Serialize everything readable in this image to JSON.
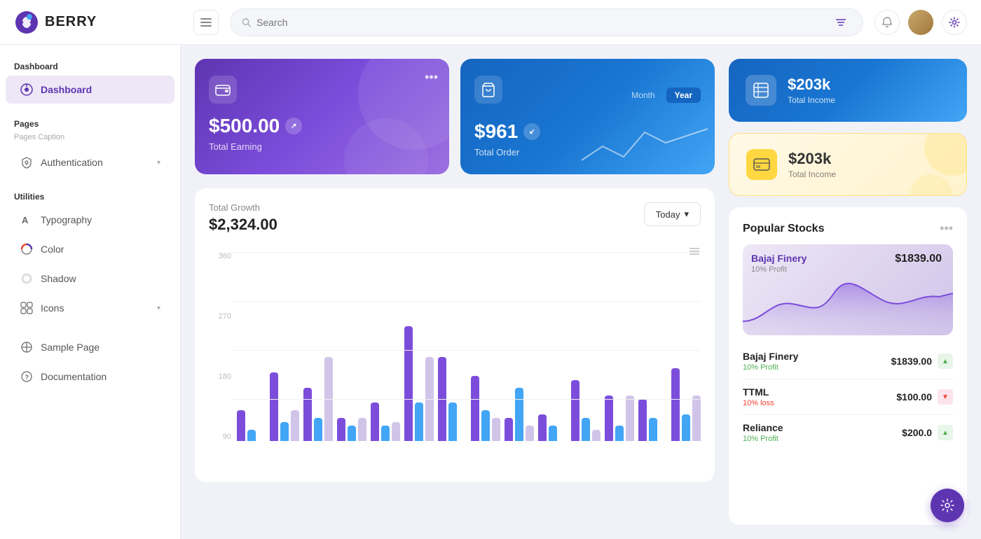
{
  "header": {
    "logo_text": "BERRY",
    "search_placeholder": "Search",
    "menu_label": "Menu"
  },
  "sidebar": {
    "dashboard_section": "Dashboard",
    "dashboard_item": "Dashboard",
    "pages_section": "Pages",
    "pages_caption": "Pages Caption",
    "authentication_item": "Authentication",
    "utilities_section": "Utilities",
    "typography_item": "Typography",
    "color_item": "Color",
    "shadow_item": "Shadow",
    "icons_item": "Icons",
    "sample_page_item": "Sample Page",
    "documentation_item": "Documentation"
  },
  "cards": {
    "earning": {
      "amount": "$500.00",
      "label": "Total Earning"
    },
    "order": {
      "amount": "$961",
      "label": "Total Order",
      "tab_month": "Month",
      "tab_year": "Year"
    },
    "income_blue": {
      "amount": "$203k",
      "label": "Total Income"
    },
    "income_yellow": {
      "amount": "$203k",
      "label": "Total Income"
    }
  },
  "growth": {
    "title": "Total Growth",
    "amount": "$2,324.00",
    "button": "Today",
    "y_labels": [
      "360",
      "270",
      "180",
      "90"
    ],
    "bars": [
      {
        "purple": 40,
        "blue": 15,
        "light": 0
      },
      {
        "purple": 90,
        "blue": 25,
        "light": 40
      },
      {
        "purple": 70,
        "blue": 30,
        "light": 110
      },
      {
        "purple": 30,
        "blue": 20,
        "light": 30
      },
      {
        "purple": 50,
        "blue": 20,
        "light": 25
      },
      {
        "purple": 150,
        "blue": 50,
        "light": 110
      },
      {
        "purple": 110,
        "blue": 50,
        "light": 0
      },
      {
        "purple": 85,
        "blue": 40,
        "light": 30
      },
      {
        "purple": 30,
        "blue": 70,
        "light": 20
      },
      {
        "purple": 35,
        "blue": 20,
        "light": 0
      },
      {
        "purple": 80,
        "blue": 30,
        "light": 15
      },
      {
        "purple": 60,
        "blue": 20,
        "light": 60
      },
      {
        "purple": 55,
        "blue": 30,
        "light": 0
      },
      {
        "purple": 95,
        "blue": 35,
        "light": 60
      }
    ]
  },
  "stocks": {
    "title": "Popular Stocks",
    "featured": {
      "name": "Bajaj Finery",
      "profit": "10% Profit",
      "price": "$1839.00"
    },
    "list": [
      {
        "name": "Bajaj Finery",
        "change": "10% Profit",
        "price": "$1839.00",
        "trend": "up"
      },
      {
        "name": "TTML",
        "change": "10% loss",
        "price": "$100.00",
        "trend": "down"
      },
      {
        "name": "Reliance",
        "change": "10% Profit",
        "price": "$200.0",
        "trend": "up"
      }
    ]
  }
}
